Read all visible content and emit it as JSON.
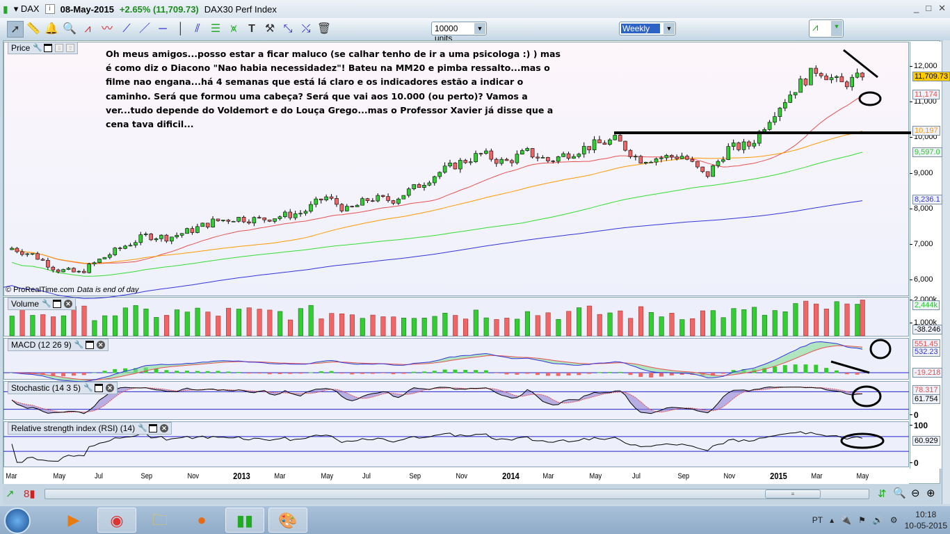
{
  "titlebar": {
    "symbol": "DAX",
    "date": "08-May-2015",
    "change": "+2.65% (11,709.73)",
    "name": "DAX30 Perf Index",
    "window_buttons": [
      "_",
      "□",
      "✕"
    ]
  },
  "toolbar": {
    "tools": [
      "pointer",
      "ruler",
      "alert",
      "zoom",
      "fan",
      "channel",
      "segment",
      "line",
      "horizontal-line",
      "vertical-line",
      "parallel-lines",
      "fibonacci",
      "regression",
      "text",
      "properties",
      "move",
      "cross-line",
      "delete"
    ],
    "units": "10000 units",
    "period": "Weekly"
  },
  "panels": {
    "price": "Price",
    "volume": "Volume",
    "macd": "MACD (12 26 9)",
    "stochastic": "Stochastic (14 3 5)",
    "rsi": "Relative strength index (RSI) (14)"
  },
  "annotation": "Oh meus amigos...posso estar a ficar maluco (se calhar tenho de ir a uma psicologa :) ) mas é como diz o Diacono \"Nao habia necessidadez\"! Bateu na MM20 e pimba ressalto...mas o filme nao engana...há 4 semanas que está lá claro e os indicadores estão a indicar o caminho. Será que formou uma cabeça? Será que vai aos 10.000 (ou perto)? Vamos a ver...tudo depende do Voldemort e do Louça Grego...mas o Professor Xavier já disse que a cena tava dificil...",
  "footer": {
    "copyright": "© ProRealTime.com",
    "data_note": "Data is end of day"
  },
  "tags": {
    "last": "11,709.73",
    "ma20": "11,174",
    "ma50": "10,197",
    "ma100": "9,597.0",
    "ma200": "8,236.1",
    "volume": "2,444k",
    "volume_osc": "-38.246",
    "macd_signal": "551.45",
    "macd": "532.23",
    "macd_hist": "-19.218",
    "stoch_k": "78.317",
    "stoch_d": "61.754",
    "rsi": "60.929"
  },
  "indicator_axis": {
    "vol_2000": "2,000k",
    "vol_1000": "1,000k",
    "stoch_0": "0",
    "rsi_100": "100",
    "rsi_0": "0"
  },
  "colors": {
    "up": "#33cc33",
    "down": "#ee6666",
    "ma20": "#e85050",
    "ma50": "#ff9900",
    "ma100": "#33dd33",
    "ma200": "#3333dd",
    "last_tag": "#ffcc00"
  },
  "taskbar": {
    "lang": "PT",
    "time": "10:18",
    "date": "10-05-2015"
  },
  "chart_data": {
    "type": "candlestick",
    "title": "DAX weekly",
    "x_ticks": [
      "Mar",
      "May",
      "Jul",
      "Sep",
      "Nov",
      "2013",
      "Mar",
      "May",
      "Jul",
      "Sep",
      "Nov",
      "2014",
      "Mar",
      "May",
      "Jul",
      "Sep",
      "Nov",
      "2015",
      "Mar",
      "May"
    ],
    "y_ticks": [
      "12,000",
      "11,000",
      "10,000",
      "9,000",
      "8,000",
      "7,000",
      "6,000"
    ],
    "ylim": [
      5900,
      12700
    ],
    "monthly_close_approx": [
      6900,
      6700,
      6300,
      6200,
      6600,
      6950,
      7250,
      7200,
      7400,
      7650,
      7750,
      7700,
      7800,
      7900,
      8350,
      7950,
      8300,
      8250,
      8600,
      9000,
      9300,
      9550,
      9300,
      9600,
      9350,
      9600,
      9800,
      9950,
      9400,
      9450,
      9500,
      8900,
      9700,
      9800,
      10700,
      11400,
      11950,
      11500,
      11709.73
    ],
    "last_close": 11709.73,
    "moving_averages": [
      {
        "name": "MA20",
        "last": 11174
      },
      {
        "name": "MA50",
        "last": 10197
      },
      {
        "name": "MA100",
        "last": 9597
      },
      {
        "name": "MA200",
        "last": 8236.1
      }
    ]
  }
}
